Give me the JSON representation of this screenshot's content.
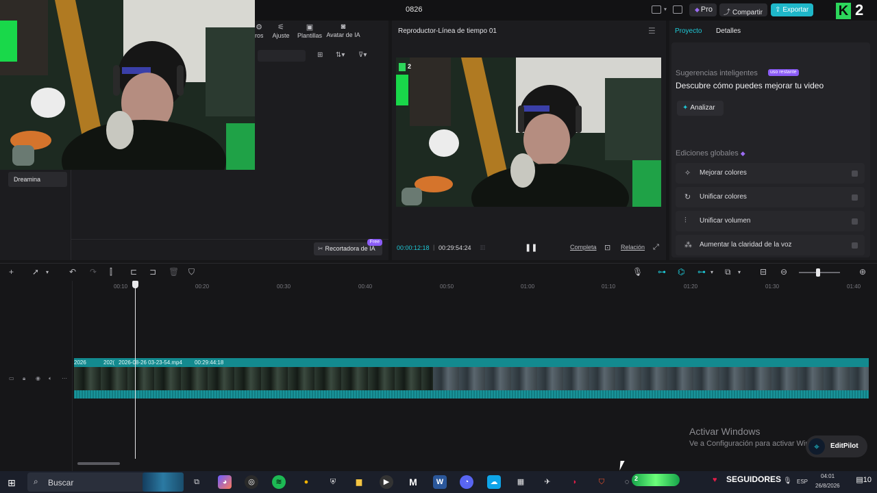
{
  "window": {
    "title": "0826"
  },
  "header": {
    "pro_label": "Pro",
    "share_label": "Compartir",
    "export_label": "Exportar",
    "overlay_number": "2"
  },
  "media": {
    "tabs": [
      "ros",
      "Ajuste",
      "Plantillas",
      "Avatar de IA"
    ],
    "sidebar_item": "Dreamina",
    "ai_cropper_label": "Recortadora de IA",
    "ai_cropper_badge": "Free"
  },
  "player": {
    "title": "Reproductor-Línea de tiempo 01",
    "overlay_number": "2",
    "current_time": "00:00:12:18",
    "total_time": "00:29:54:24",
    "full_label": "Completa",
    "ratio_label": "Relación"
  },
  "right_panel": {
    "tab_project": "Proyecto",
    "tab_details": "Detalles",
    "suggestions_label": "Sugerencias inteligentes",
    "suggestions_badge": "uso restante",
    "suggestions_heading": "Descubre cómo puedes mejorar tu video",
    "analyze_label": "Analizar",
    "global_edits_label": "Ediciones globales",
    "global_edits": [
      {
        "label": "Mejorar colores",
        "icon": "magic-wand-icon"
      },
      {
        "label": "Unificar colores",
        "icon": "color-sync-icon"
      },
      {
        "label": "Unificar volumen",
        "icon": "equalizer-icon"
      },
      {
        "label": "Aumentar la claridad de la voz",
        "icon": "voice-sparkle-icon"
      }
    ]
  },
  "timeline": {
    "ruler": [
      "00:10",
      "00:20",
      "00:30",
      "00:40",
      "00:50",
      "01:00",
      "01:10",
      "01:20",
      "01:30",
      "01:40"
    ],
    "clip_labels": [
      "2026",
      "202(",
      "2026-08-26 03-23-54.mp4",
      "00:29:44:18"
    ]
  },
  "windows_activation": {
    "title": "Activar Windows",
    "subtitle": "Ve a Configuración para activar Windows."
  },
  "editpilot_label": "EditPilot",
  "taskbar": {
    "search_placeholder": "Buscar",
    "followers_number": "2",
    "followers_label": "SEGUIDORES",
    "lang": "ESP",
    "time": "04:01",
    "date": "26/8/2026",
    "notification_count": "10"
  },
  "colors": {
    "accent": "#1fc8d6",
    "export": "#1fb7c9",
    "premium": "#8b5cf6",
    "clip": "#138a8f"
  }
}
